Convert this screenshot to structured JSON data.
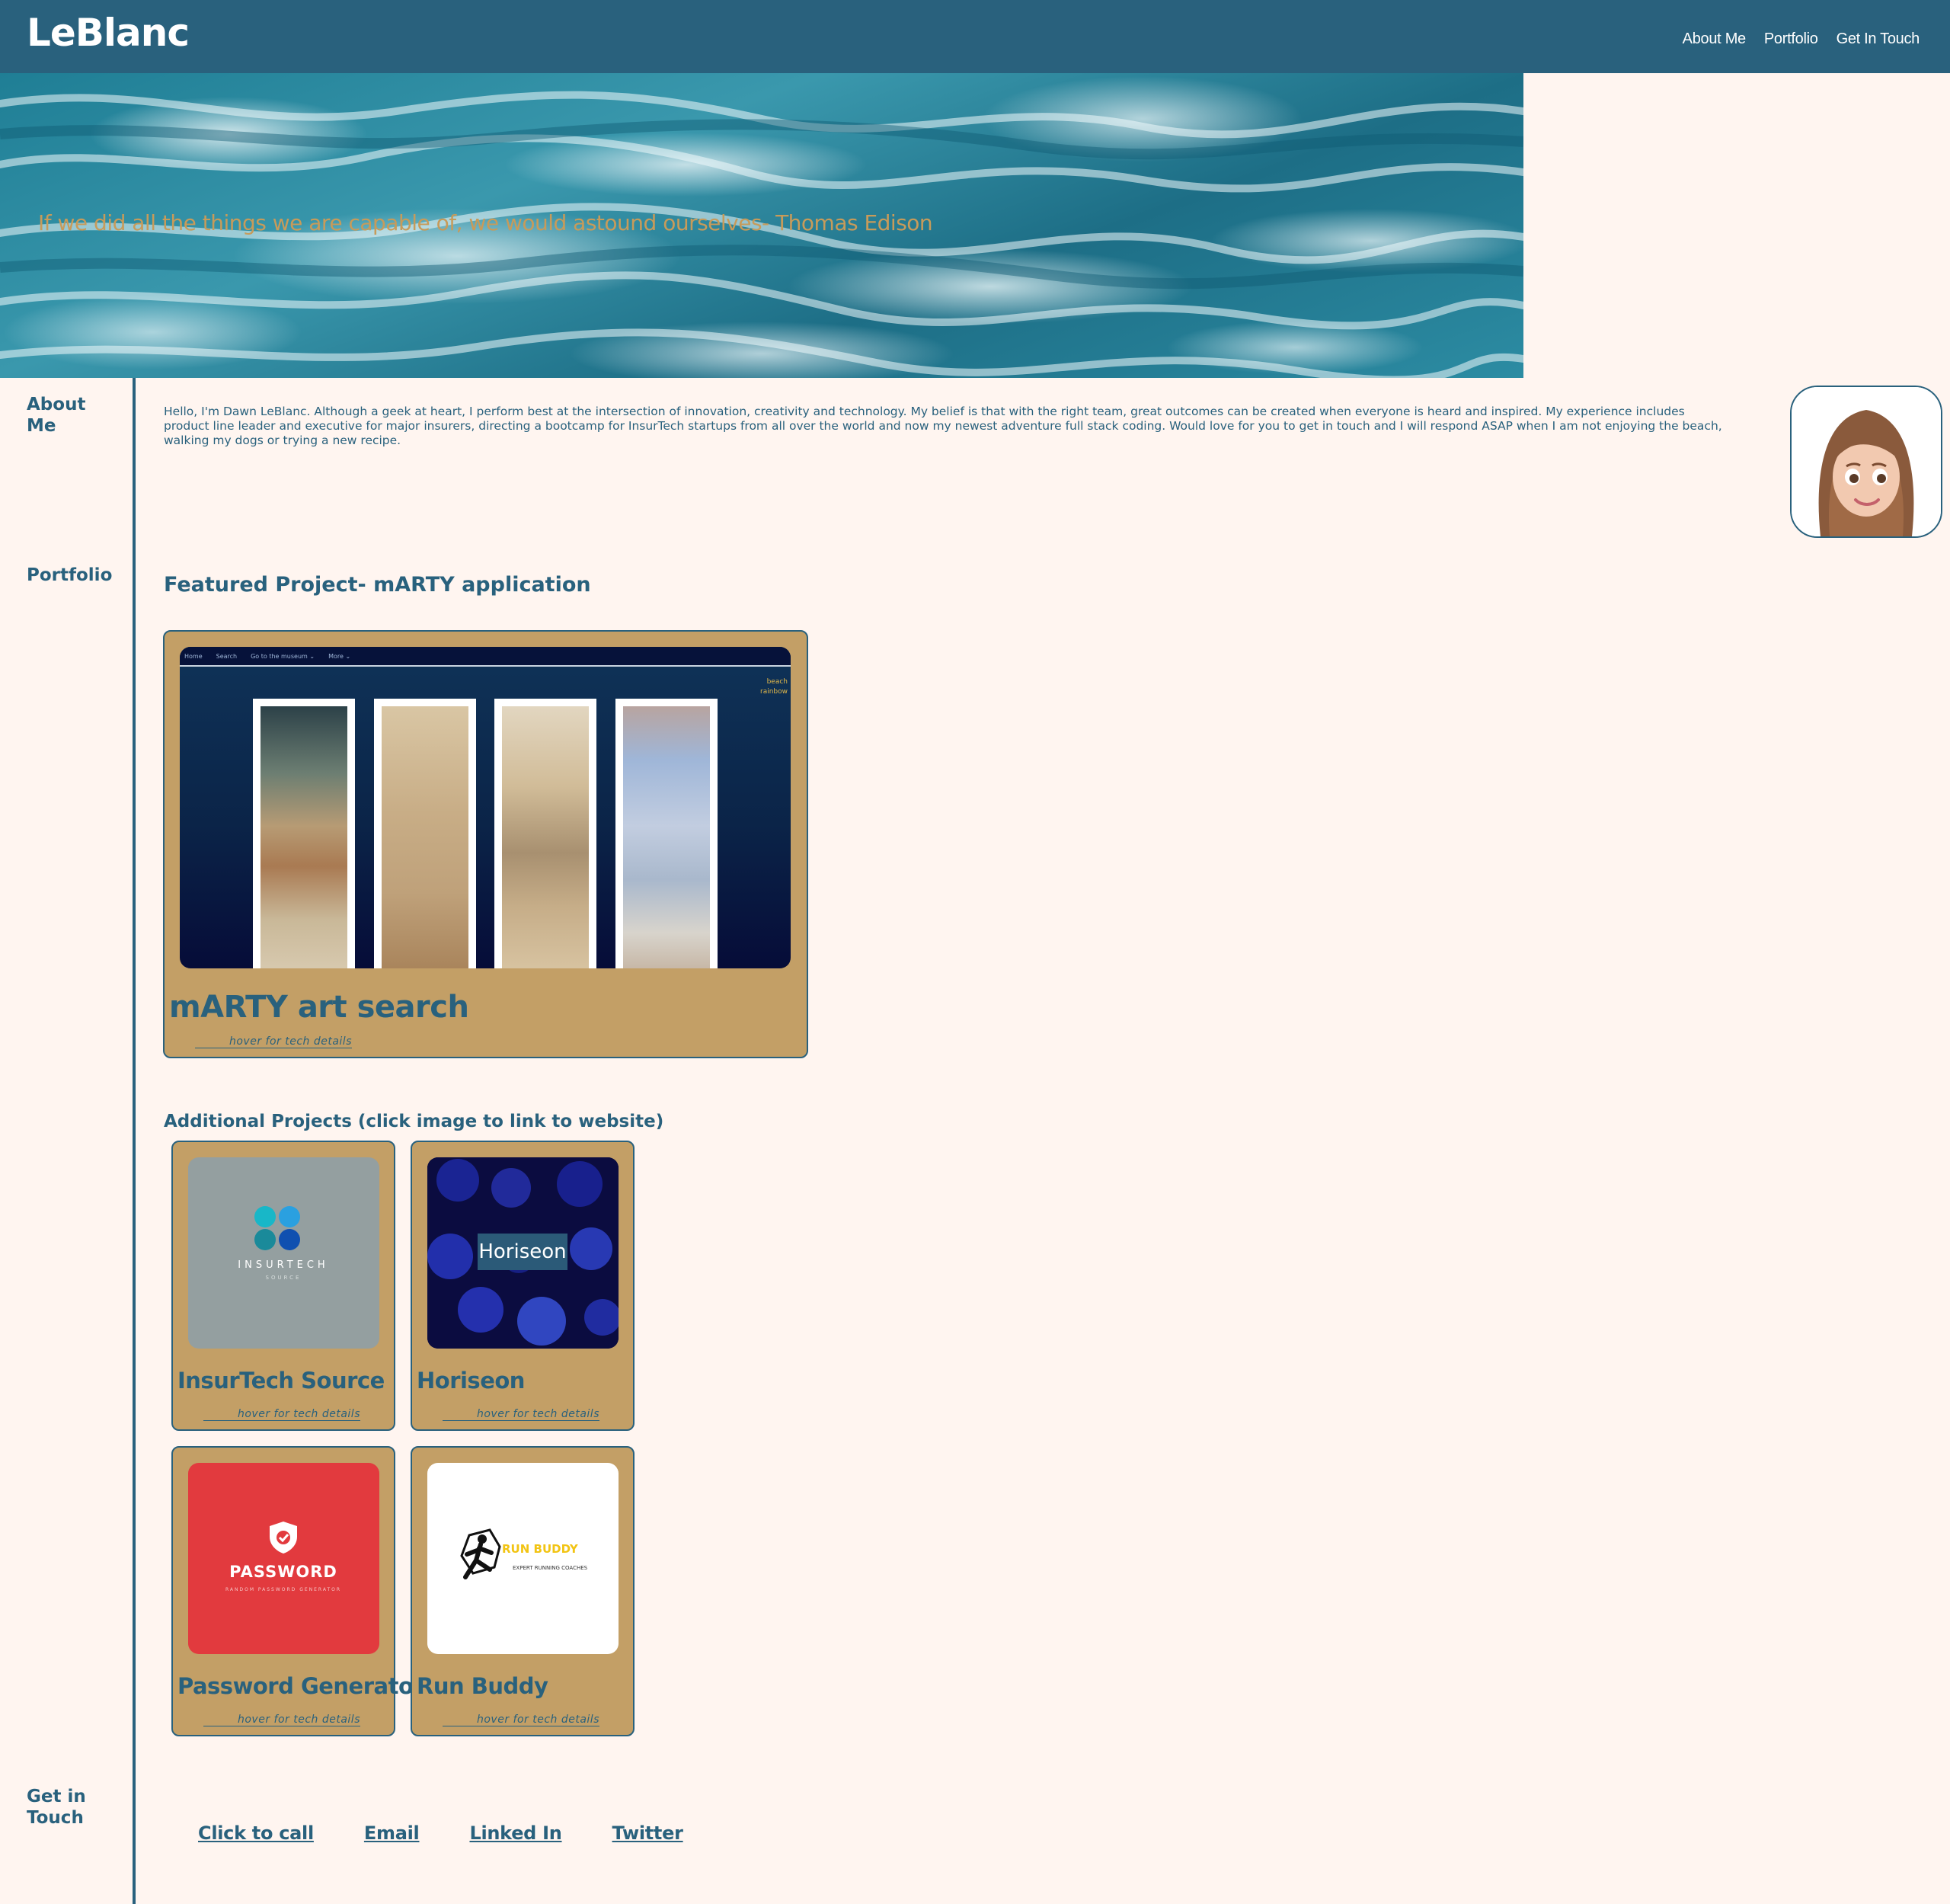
{
  "header": {
    "brand": "LeBlanc",
    "nav": [
      "About Me",
      "Portfolio",
      "Get In Touch"
    ]
  },
  "hero": {
    "quote": "If we did all the things we are capable of, we would astound ourselves- Thomas Edison"
  },
  "sidebar": {
    "about_label": "About Me",
    "portfolio_label": "Portfolio",
    "contact_label": "Get in Touch"
  },
  "about": {
    "text": "Hello, I'm Dawn LeBlanc.  Although a geek at heart, I perform best at the intersection of innovation, creativity and technology.  My belief is that with the right team, great outcomes can be created when everyone is heard and inspired.  My experience includes product line leader and executive for major insurers, directing a bootcamp for InsurTech startups from all over the world and now my newest adventure full stack coding.  Would love for you to get in touch and I will respond ASAP when I am not enjoying the beach, walking my dogs or trying a new recipe."
  },
  "featured": {
    "heading": "Featured Project- mARTY application",
    "title": "mARTY art search",
    "hint": "hover for tech details",
    "screenshot": {
      "nav": [
        "Home",
        "Search",
        "Go to the museum ⌄",
        "More ⌄"
      ],
      "side_links": [
        "beach",
        "rainbow"
      ]
    }
  },
  "additional": {
    "heading": "Additional Projects (click image to link to website)",
    "projects": [
      {
        "title": "InsurTech Source",
        "hint": "hover for tech details",
        "logo_text": "INSURTECH",
        "logo_sub": "SOURCE"
      },
      {
        "title": "Horiseon",
        "hint": "hover for tech details",
        "logo_text": "Horiseon"
      },
      {
        "title": "Password Generator",
        "hint": "hover for tech details",
        "logo_text": "PASSWORD",
        "logo_sub": "RANDOM PASSWORD GENERATOR"
      },
      {
        "title": "Run Buddy",
        "hint": "hover for tech details",
        "logo_text": "RUN BUDDY",
        "logo_sub": "EXPERT RUNNING COACHES"
      }
    ]
  },
  "contact": {
    "links": [
      "Click to call",
      "Email",
      "Linked In",
      "Twitter"
    ]
  },
  "colors": {
    "primary": "#29617d",
    "background": "#fff5f0",
    "card": "#c39f66",
    "quote": "#c79b5a"
  }
}
